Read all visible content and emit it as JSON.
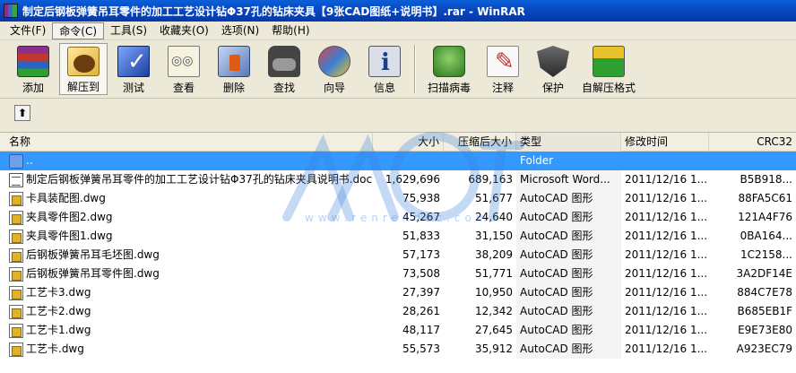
{
  "window": {
    "title": "制定后钢板弹簧吊耳零件的加工工艺设计钻Φ37孔的钻床夹具【9张CAD图纸+说明书】.rar - WinRAR"
  },
  "menu": [
    {
      "label": "文件(F)",
      "active": false
    },
    {
      "label": "命令(C)",
      "active": true
    },
    {
      "label": "工具(S)",
      "active": false
    },
    {
      "label": "收藏夹(O)",
      "active": false
    },
    {
      "label": "选项(N)",
      "active": false
    },
    {
      "label": "帮助(H)",
      "active": false
    }
  ],
  "toolbar": [
    {
      "label": "添加",
      "icon": "add-archive-icon"
    },
    {
      "label": "解压到",
      "icon": "extract-to-icon",
      "pressed": true
    },
    {
      "label": "测试",
      "icon": "test-icon"
    },
    {
      "label": "查看",
      "icon": "view-icon"
    },
    {
      "label": "删除",
      "icon": "delete-icon"
    },
    {
      "label": "查找",
      "icon": "find-icon"
    },
    {
      "label": "向导",
      "icon": "wizard-icon"
    },
    {
      "label": "信息",
      "icon": "info-icon"
    },
    {
      "label": "扫描病毒",
      "icon": "scan-virus-icon"
    },
    {
      "label": "注释",
      "icon": "comment-icon"
    },
    {
      "label": "保护",
      "icon": "protect-icon"
    },
    {
      "label": "自解压格式",
      "icon": "sfx-icon"
    }
  ],
  "columns": {
    "name": "名称",
    "size": "大小",
    "packed": "压缩后大小",
    "type": "类型",
    "modified": "修改时间",
    "crc": "CRC32"
  },
  "rows": [
    {
      "name": "..",
      "size": "",
      "packed": "",
      "type": "Folder",
      "modified": "",
      "crc": "",
      "icon": "folder-icon",
      "selected": true
    },
    {
      "name": "制定后钢板弹簧吊耳零件的加工工艺设计钻Φ37孔的钻床夹具说明书.doc",
      "size": "1,629,696",
      "packed": "689,163",
      "type": "Microsoft Word...",
      "modified": "2011/12/16 1...",
      "crc": "B5B918...",
      "icon": "word-document-icon"
    },
    {
      "name": "卡具装配图.dwg",
      "size": "75,938",
      "packed": "51,677",
      "type": "AutoCAD 图形",
      "modified": "2011/12/16 1...",
      "crc": "88FA5C61",
      "icon": "dwg-file-icon"
    },
    {
      "name": "夹具零件图2.dwg",
      "size": "45,267",
      "packed": "24,640",
      "type": "AutoCAD 图形",
      "modified": "2011/12/16 1...",
      "crc": "121A4F76",
      "icon": "dwg-file-icon"
    },
    {
      "name": "夹具零件图1.dwg",
      "size": "51,833",
      "packed": "31,150",
      "type": "AutoCAD 图形",
      "modified": "2011/12/16 1...",
      "crc": "0BA164...",
      "icon": "dwg-file-icon"
    },
    {
      "name": "后钢板弹簧吊耳毛坯图.dwg",
      "size": "57,173",
      "packed": "38,209",
      "type": "AutoCAD 图形",
      "modified": "2011/12/16 1...",
      "crc": "1C2158...",
      "icon": "dwg-file-icon"
    },
    {
      "name": "后钢板弹簧吊耳零件图.dwg",
      "size": "73,508",
      "packed": "51,771",
      "type": "AutoCAD 图形",
      "modified": "2011/12/16 1...",
      "crc": "3A2DF14E",
      "icon": "dwg-file-icon"
    },
    {
      "name": "工艺卡3.dwg",
      "size": "27,397",
      "packed": "10,950",
      "type": "AutoCAD 图形",
      "modified": "2011/12/16 1...",
      "crc": "884C7E78",
      "icon": "dwg-file-icon"
    },
    {
      "name": "工艺卡2.dwg",
      "size": "28,261",
      "packed": "12,342",
      "type": "AutoCAD 图形",
      "modified": "2011/12/16 1...",
      "crc": "B685EB1F",
      "icon": "dwg-file-icon"
    },
    {
      "name": "工艺卡1.dwg",
      "size": "48,117",
      "packed": "27,645",
      "type": "AutoCAD 图形",
      "modified": "2011/12/16 1...",
      "crc": "E9E73E80",
      "icon": "dwg-file-icon"
    },
    {
      "name": "工艺卡.dwg",
      "size": "55,573",
      "packed": "35,912",
      "type": "AutoCAD 图形",
      "modified": "2011/12/16 1...",
      "crc": "A923EC79",
      "icon": "dwg-file-icon"
    }
  ],
  "watermark": {
    "text": "www.renrendoc.com"
  },
  "colors": {
    "titlebar": "#0748c2",
    "selection": "#3399ff",
    "chrome": "#ece9d8"
  }
}
